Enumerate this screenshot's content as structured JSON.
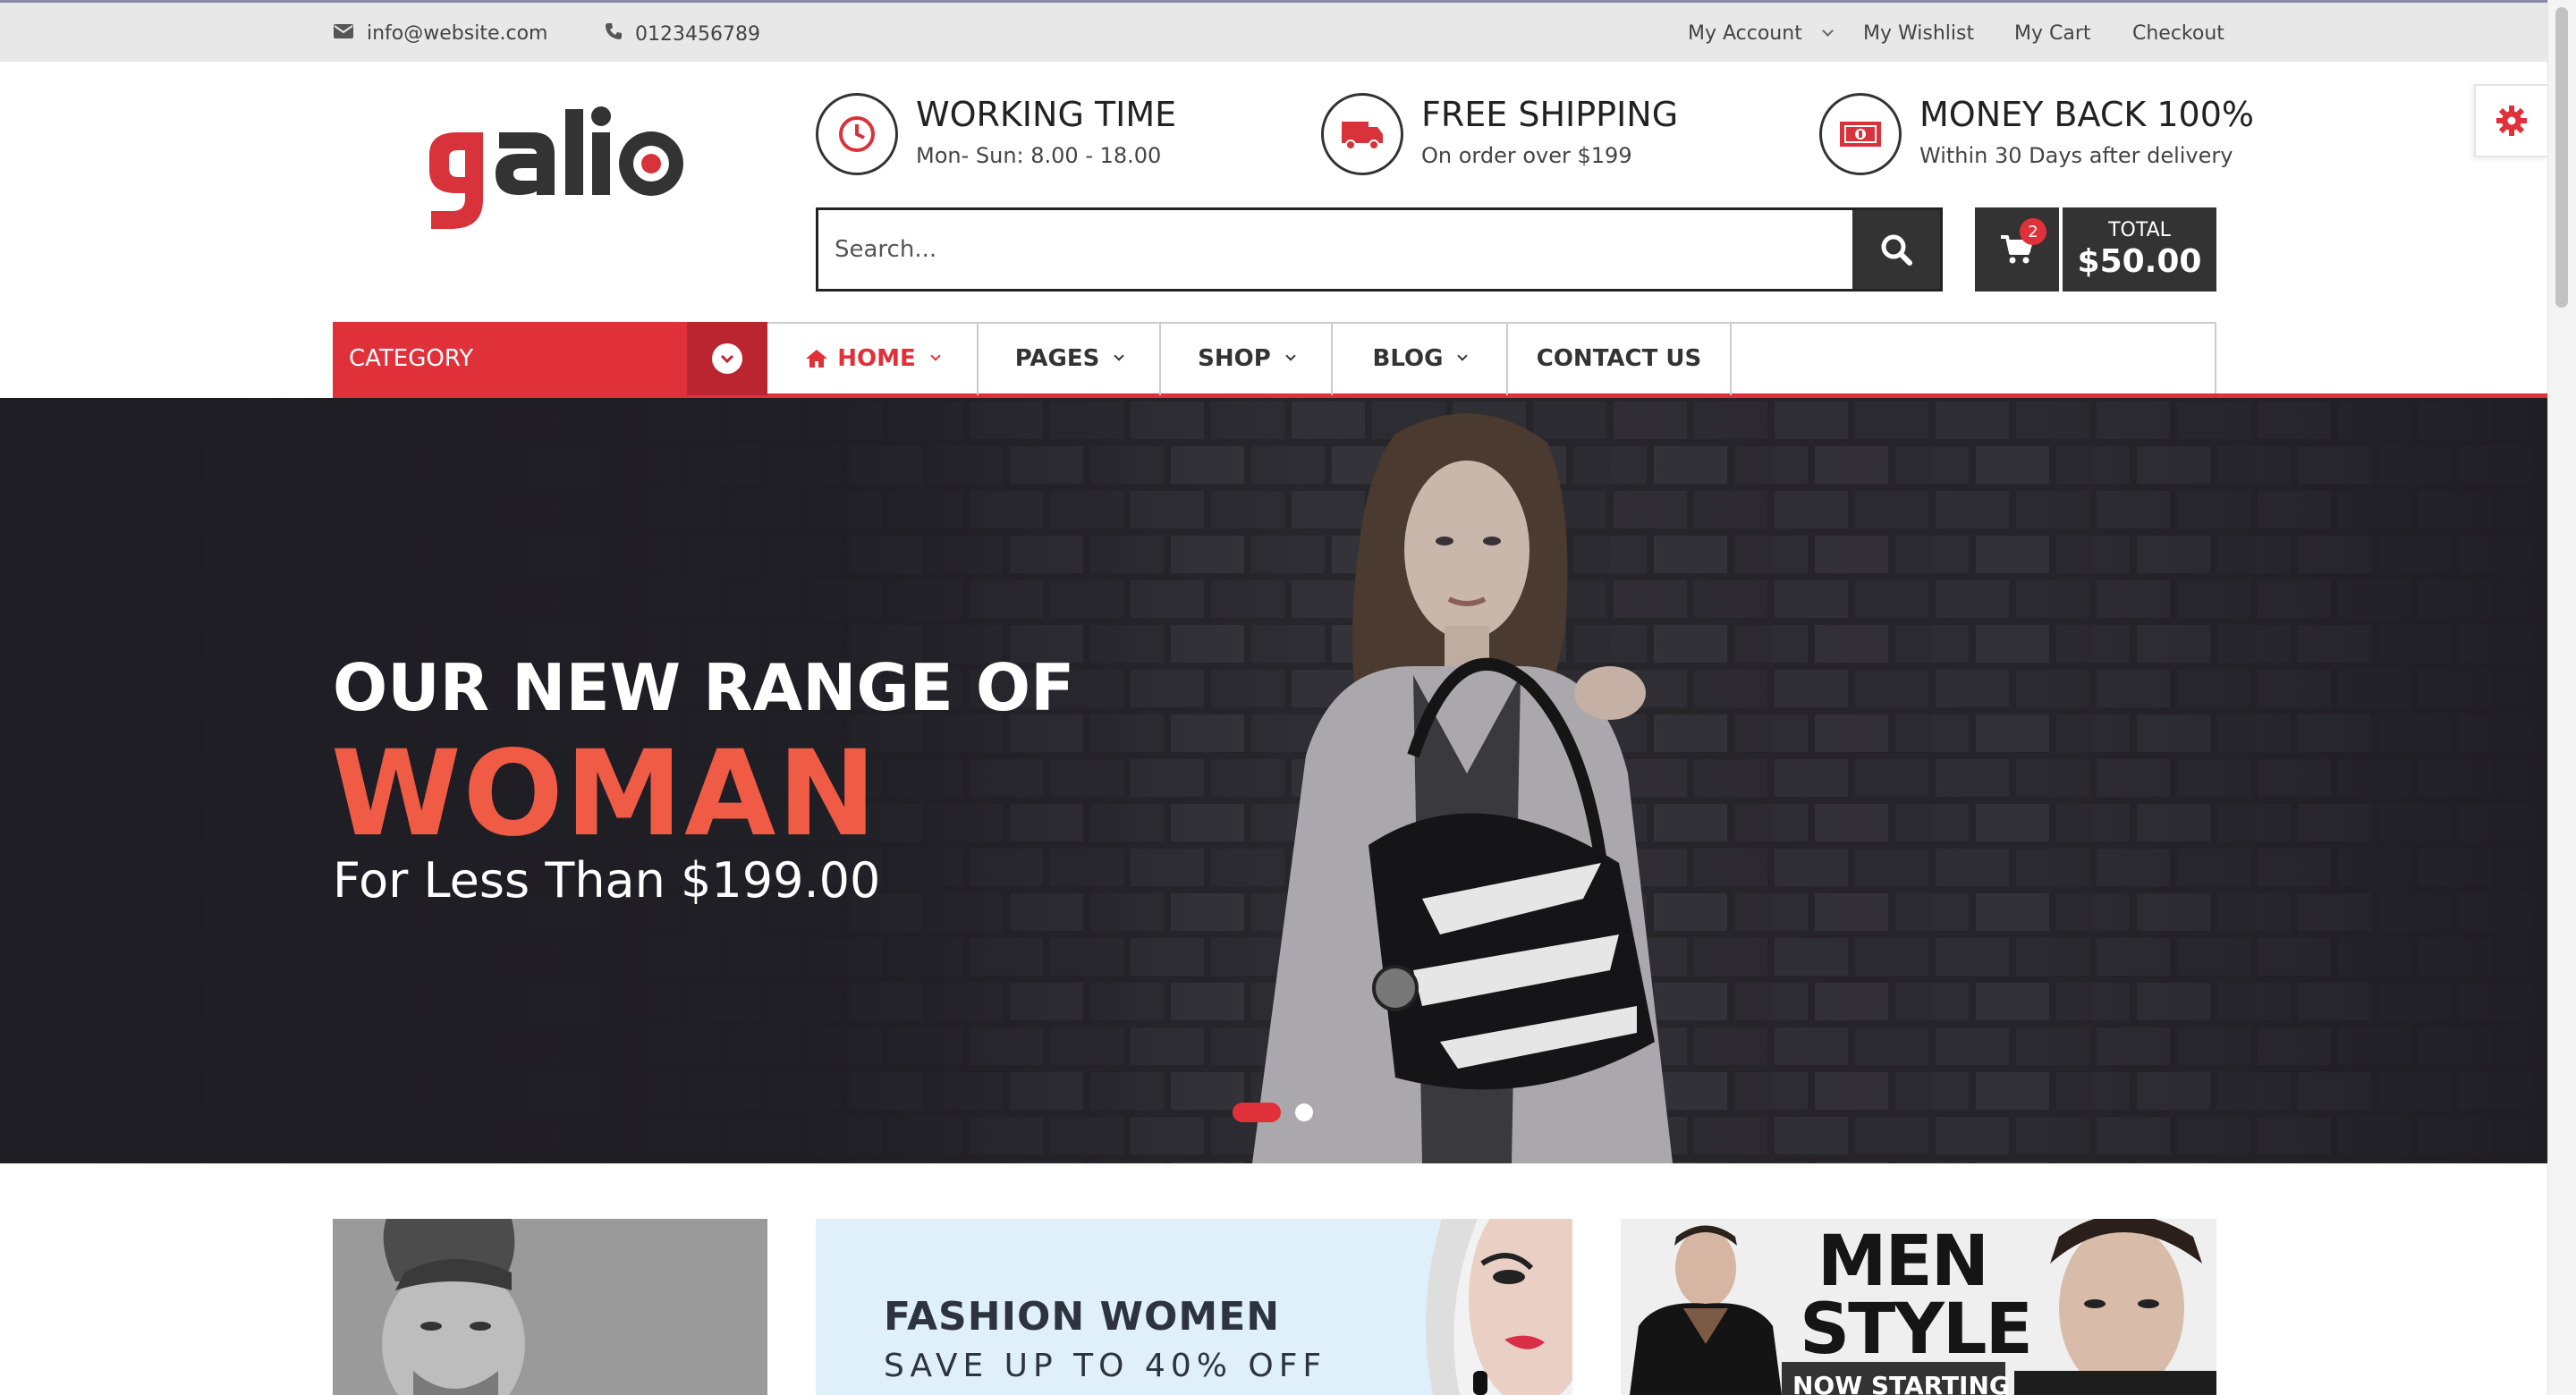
{
  "topbar": {
    "email": "info@website.com",
    "phone": "0123456789",
    "links": [
      "My Account",
      "My Wishlist",
      "My Cart",
      "Checkout"
    ]
  },
  "logo": {
    "text": "galio"
  },
  "features": [
    {
      "title": "WORKING TIME",
      "subtitle": "Mon- Sun: 8.00 - 18.00",
      "icon": "clock-icon"
    },
    {
      "title": "FREE SHIPPING",
      "subtitle": "On order over $199",
      "icon": "truck-icon"
    },
    {
      "title": "MONEY BACK 100%",
      "subtitle": "Within 30 Days after delivery",
      "icon": "money-icon"
    }
  ],
  "search": {
    "placeholder": "Search..."
  },
  "cart": {
    "count": "2",
    "total_label": "TOTAL",
    "total_value": "$50.00"
  },
  "nav": {
    "category_label": "CATEGORY",
    "items": [
      "HOME",
      "PAGES",
      "SHOP",
      "BLOG",
      "CONTACT US"
    ]
  },
  "hero": {
    "line1": "OUR NEW RANGE OF",
    "line2": "WOMAN",
    "line3": "For Less Than $199.00"
  },
  "banners": {
    "women_title": "FASHION WOMEN",
    "women_subtitle": "SAVE UP TO 40% OFF",
    "men_title": "MEN STYLE",
    "men_subtitle": "NOW STARTING"
  },
  "colors": {
    "accent": "#e0313b",
    "hero_highlight": "#ef5b45",
    "dark": "#333333"
  }
}
